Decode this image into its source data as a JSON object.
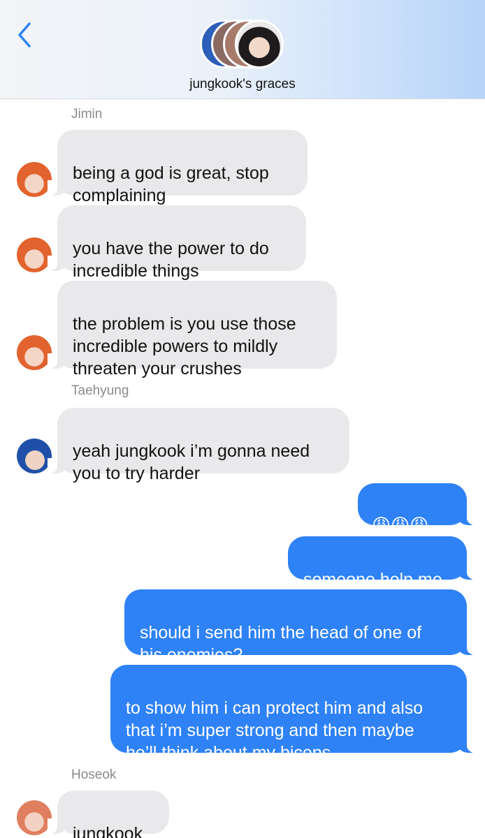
{
  "header": {
    "group_name": "jungkook's graces",
    "back_icon": "chevron-left-icon",
    "accent": "#2f82f6"
  },
  "messages": [
    {
      "sender": "Jimin",
      "text": "being a god is great, stop\ncomplaining",
      "direction": "incoming"
    },
    {
      "sender": "Jimin",
      "text": "you have the power to do\nincredible things",
      "direction": "incoming"
    },
    {
      "sender": "Jimin",
      "text": "the problem is you use those\nincredible powers to mildly\nthreaten your crushes",
      "direction": "incoming"
    },
    {
      "sender": "Taehyung",
      "text": "yeah jungkook i’m gonna need\nyou to try harder",
      "direction": "incoming"
    },
    {
      "sender": "",
      "text": "😩😩😩",
      "direction": "outgoing"
    },
    {
      "sender": "",
      "text": "someone help me",
      "direction": "outgoing"
    },
    {
      "sender": "",
      "text": "should i send him the head of one of\nhis enemies?",
      "direction": "outgoing"
    },
    {
      "sender": "",
      "text": "to show him i can protect him and also\nthat i’m super strong and then maybe\nhe’ll think about my biceps",
      "direction": "outgoing"
    },
    {
      "sender": "Hoseok",
      "text": "jungkook",
      "direction": "incoming"
    }
  ],
  "colors": {
    "incoming_bubble": "#e9e9eb",
    "outgoing_bubble": "#2f82f6",
    "sender_label": "#8a8a8f"
  }
}
